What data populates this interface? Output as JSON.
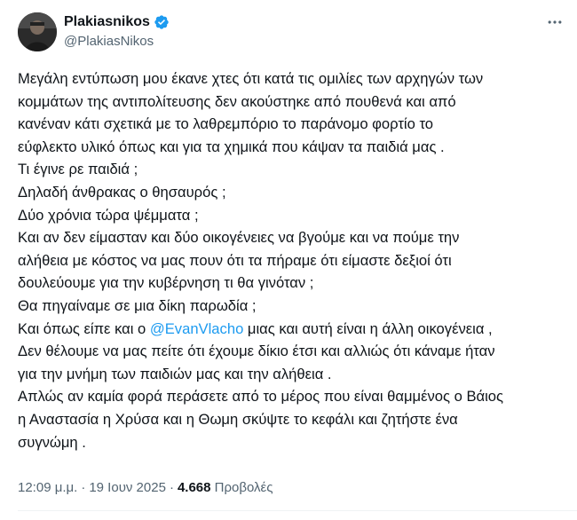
{
  "author": {
    "name": "Plakiasnikos",
    "handle": "@PlakiasNikos"
  },
  "icons": {
    "verified": "verified-badge-icon",
    "more": "more-horizontal-icon",
    "avatar": "profile-photo"
  },
  "colors": {
    "verified": "#1d9bf0",
    "mention": "#1d9bf0",
    "secondary_text": "#536471"
  },
  "tweet": {
    "line_1": "Μεγάλη εντύπωση μου έκανε χτες ότι κατά τις ομιλίες των αρχηγών των",
    "line_2": "κομμάτων της αντιπολίτευσης δεν ακούστηκε από πουθενά και από",
    "line_3": "κανέναν κάτι σχετικά με το λαθρεμπόριο το παράνομο φορτίο το",
    "line_4": "εύφλεκτο υλικό όπως και για τα χημικά που κάψαν τα παιδιά μας .",
    "line_5": "Τι έγινε ρε παιδιά ;",
    "line_6": "Δηλαδή άνθρακας ο θησαυρός ;",
    "line_7": "Δύο χρόνια τώρα ψέμματα ;",
    "line_8": "Και αν δεν είμασταν και δύο οικογένειες να βγούμε και να πούμε την",
    "line_9": "αλήθεια με κόστος να μας πουν ότι τα πήραμε ότι είμαστε δεξιοί ότι",
    "line_10": "δουλεύουμε για την κυβέρνηση τι θα γινόταν ;",
    "line_11": "Θα πηγαίναμε σε μια δίκη παρωδία ;",
    "line_12_before": "Και όπως είπε και ο ",
    "line_12_mention": "@EvanVlacho",
    "line_12_after": " μιας και αυτή είναι η άλλη οικογένεια ,",
    "line_13": "Δεν θέλουμε να μας πείτε ότι έχουμε δίκιο έτσι και αλλιώς ότι κάναμε ήταν",
    "line_14": "για την μνήμη των παιδιών μας και την αλήθεια .",
    "line_15": "Απλώς αν καμία φορά περάσετε από το μέρος που είναι θαμμένος ο Βάιος",
    "line_16": "η Αναστασία η Χρύσα και η Θωμη σκύψτε το κεφάλι και ζητήστε ένα",
    "line_17": "συγνώμη ."
  },
  "meta": {
    "time": "12:09 μ.μ.",
    "separator": "·",
    "date": "19 Ιουν 2025",
    "views_count": "4.668",
    "views_label": "Προβολές"
  }
}
